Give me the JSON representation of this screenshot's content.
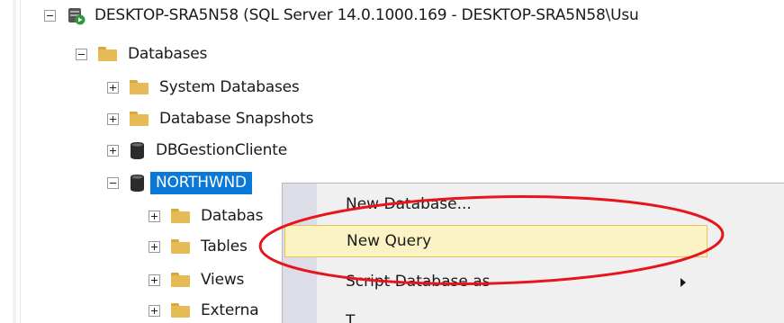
{
  "tree": {
    "server_label": "DESKTOP-SRA5N58 (SQL Server 14.0.1000.169 - DESKTOP-SRA5N58\\Usu",
    "databases_label": "Databases",
    "system_databases_label": "System Databases",
    "database_snapshots_label": "Database Snapshots",
    "dbgestion_label": "DBGestionCliente",
    "northwnd_label": "NORTHWND",
    "northwnd_children": [
      {
        "label": "Databas"
      },
      {
        "label": "Tables"
      },
      {
        "label": "Views"
      },
      {
        "label": "Externa"
      }
    ]
  },
  "context_menu": {
    "items": [
      {
        "label": "New Database...",
        "has_submenu": false
      },
      {
        "label": "New Query",
        "has_submenu": false
      },
      {
        "label": "Script Database as",
        "has_submenu": true
      },
      {
        "label": "T",
        "has_submenu": false
      }
    ]
  },
  "colors": {
    "selection": "#0a78d7",
    "hover_fill": "#fbf3c4",
    "annotation_red": "#e8141b"
  }
}
